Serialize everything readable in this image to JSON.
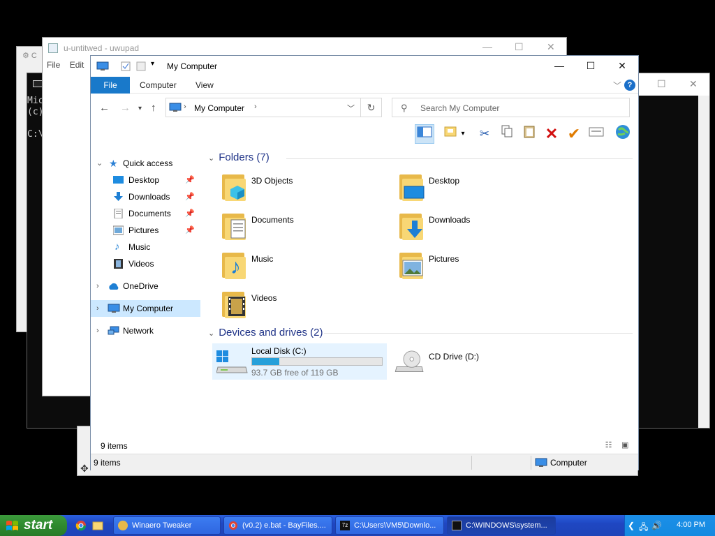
{
  "background": {
    "uwupad_title": "u-untitwed - uwupad",
    "uwupad_menu": [
      "File",
      "Edit"
    ],
    "console_lines": [
      "Mic",
      "(c)",
      "",
      "C:\\"
    ]
  },
  "explorer": {
    "title": "My Computer",
    "ribbon_tabs": [
      "File",
      "Computer",
      "View"
    ],
    "help": "?",
    "address": "My Computer",
    "search_placeholder": "Search My Computer",
    "nav": {
      "quick_access": "Quick access",
      "desktop": "Desktop",
      "downloads": "Downloads",
      "documents": "Documents",
      "pictures": "Pictures",
      "music": "Music",
      "videos": "Videos",
      "onedrive": "OneDrive",
      "my_computer": "My Computer",
      "network": "Network"
    },
    "folders_header": "Folders (7)",
    "folders": [
      "3D Objects",
      "Desktop",
      "Documents",
      "Downloads",
      "Music",
      "Pictures",
      "Videos"
    ],
    "drives_header": "Devices and drives (2)",
    "drive_c": {
      "name": "Local Disk (C:)",
      "free": "93.7 GB free of 119 GB",
      "used_fraction": 0.21
    },
    "drive_d": {
      "name": "CD Drive (D:)"
    },
    "status_count": "9 items",
    "status2_count": "9 items",
    "status2_zone": "Computer"
  },
  "taskbar": {
    "start": "start",
    "tasks": [
      "Winaero Tweaker",
      "(v0.2) e.bat - BayFiles....",
      "C:\\Users\\VM5\\Downlo...",
      "C:\\WINDOWS\\system..."
    ],
    "clock": "4:00 PM"
  },
  "colors": {
    "accent": "#1979ca",
    "taskbar": "#1f47c2",
    "start": "#2f8a2f",
    "folder": "#f8d775"
  }
}
